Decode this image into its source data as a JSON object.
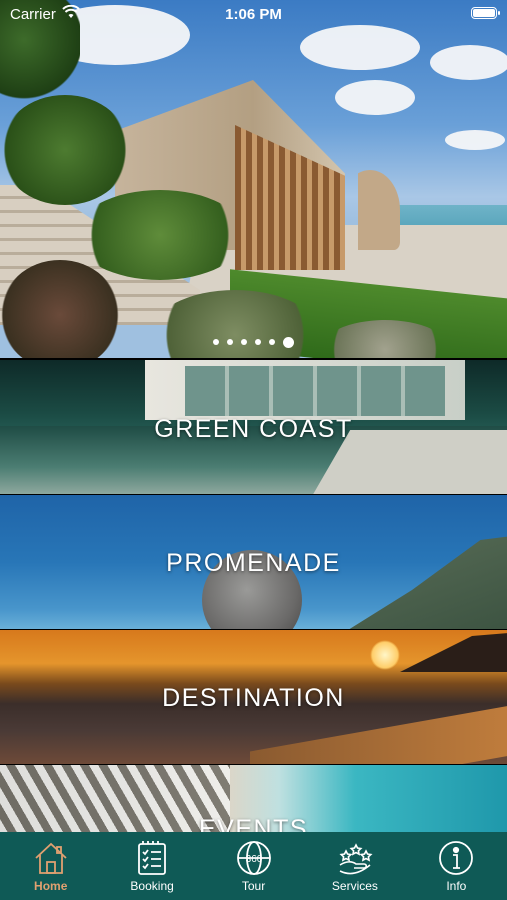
{
  "status_bar": {
    "carrier": "Carrier",
    "time": "1:06 PM"
  },
  "hero": {
    "page_count": 6,
    "active_page": 6
  },
  "sections": [
    {
      "id": "green-coast",
      "label": "GREEN COAST"
    },
    {
      "id": "promenade",
      "label": "PROMENADE"
    },
    {
      "id": "destination",
      "label": "DESTINATION"
    },
    {
      "id": "events",
      "label": "EVENTS"
    }
  ],
  "tab_bar": {
    "active_color": "#e0a070",
    "background": "#0f5a56",
    "tabs": [
      {
        "label": "Home",
        "icon": "house-icon",
        "active": true
      },
      {
        "label": "Booking",
        "icon": "booking-checklist-icon",
        "active": false
      },
      {
        "label": "Tour",
        "icon": "360-tour-icon",
        "active": false
      },
      {
        "label": "Services",
        "icon": "services-hand-stars-icon",
        "active": false
      },
      {
        "label": "Info",
        "icon": "info-icon",
        "active": false
      }
    ]
  }
}
